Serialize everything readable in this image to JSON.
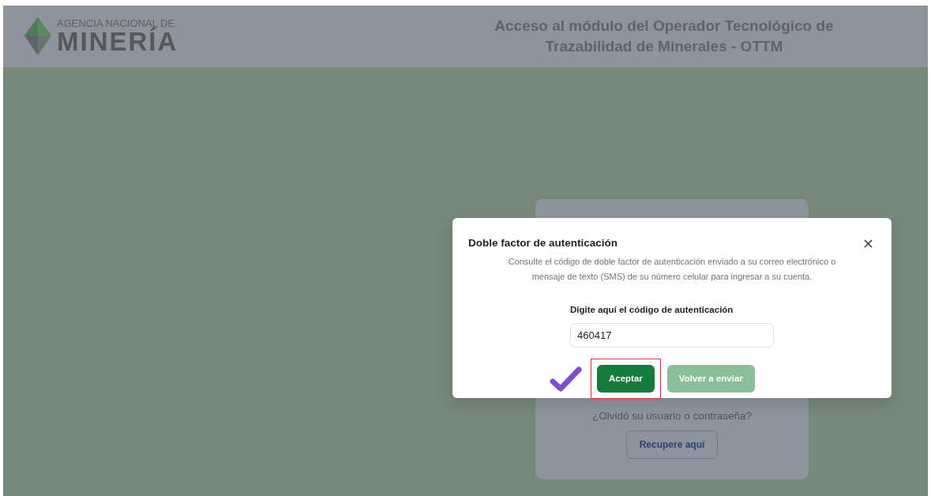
{
  "header": {
    "logo_top": "AGENCIA NACIONAL DE",
    "logo_bottom": "MINERÍA",
    "title": "Acceso al módulo del Operador Tecnológico de Trazabilidad de Minerales - OTTM"
  },
  "login_card": {
    "forgot_text": "¿Olvidó su usuario o contraseña?",
    "recover_button": "Recupere aquí"
  },
  "modal": {
    "title": "Doble factor de autenticación",
    "description": "Consulte el código de doble factor de autenticación enviado a su correo electrónico o mensaje de texto (SMS) de su número celular para ingresar a su cuenta.",
    "code_label": "Digite aquí el código de autenticación",
    "code_value": "460417",
    "buttons": [
      {
        "label": "Aceptar",
        "disabled": false,
        "highlighted": true
      },
      {
        "label": "Volver a enviar",
        "disabled": true,
        "highlighted": false
      }
    ]
  }
}
